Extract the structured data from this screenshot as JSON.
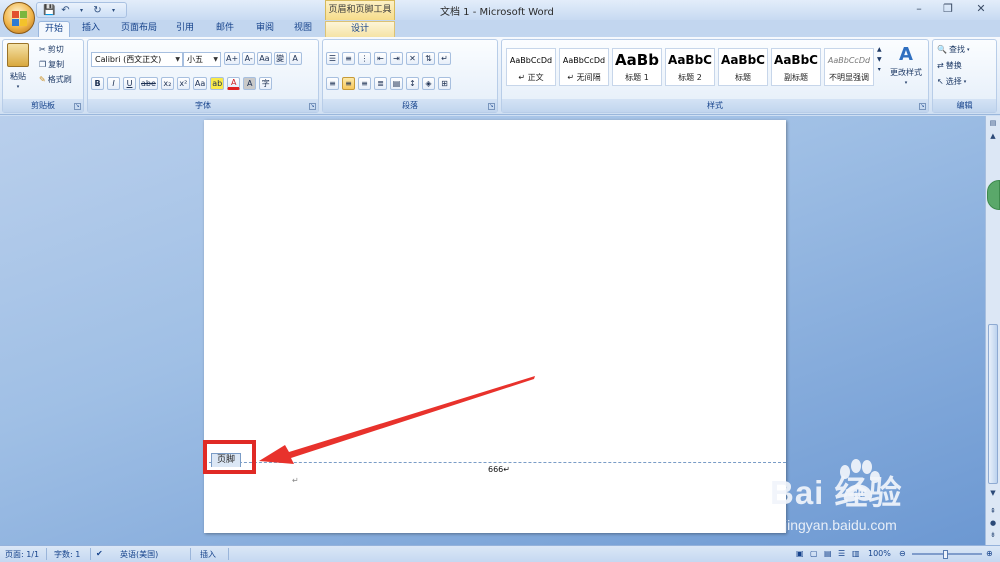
{
  "app": {
    "window_title": "文档 1 - Microsoft Word",
    "contextual_group": "页眉和页脚工具"
  },
  "tabs": [
    {
      "label": "开始",
      "active": true
    },
    {
      "label": "插入"
    },
    {
      "label": "页面布局"
    },
    {
      "label": "引用"
    },
    {
      "label": "邮件"
    },
    {
      "label": "审阅"
    },
    {
      "label": "视图"
    },
    {
      "label": "设计",
      "contextual": true
    }
  ],
  "ribbon": {
    "clipboard": {
      "label": "剪贴板",
      "paste": "粘贴",
      "cut": "剪切",
      "copy": "复制",
      "format_painter": "格式刷"
    },
    "font": {
      "label": "字体",
      "font_name": "Calibri (西文正文)",
      "font_size": "小五",
      "grow_font": "A+",
      "shrink_font": "A-",
      "clear_format": "Aa",
      "phonetic": "變",
      "char_border": "A",
      "bold": "B",
      "italic": "I",
      "underline": "U",
      "strikethrough": "abe",
      "subscript": "x₂",
      "superscript": "x²",
      "change_case": "Aa",
      "highlight": "ab",
      "font_color": "A",
      "char_shading": "A",
      "enclosed": "字"
    },
    "paragraph": {
      "label": "段落"
    },
    "styles": {
      "label": "样式",
      "items": [
        {
          "sample": "AaBbCcDd",
          "name": "↵ 正文"
        },
        {
          "sample": "AaBbCcDd",
          "name": "↵ 无间隔"
        },
        {
          "sample": "AaBb",
          "name": "标题 1"
        },
        {
          "sample": "AaBbC",
          "name": "标题 2"
        },
        {
          "sample": "AaBbC",
          "name": "标题"
        },
        {
          "sample": "AaBbC",
          "name": "副标题"
        },
        {
          "sample": "AaBbCcDd",
          "name": "不明显强调"
        }
      ],
      "change_styles": "更改样式"
    },
    "editing": {
      "label": "编辑",
      "find": "查找",
      "replace": "替换",
      "select": "选择"
    }
  },
  "document": {
    "footer_tag": "页脚",
    "footer_text": "666↵",
    "para_mark": "↵"
  },
  "statusbar": {
    "page": "页面: 1/1",
    "words": "字数: 1",
    "language": "英语(美国)",
    "mode": "插入",
    "zoom": "100%"
  },
  "watermark": {
    "brand": "Bai  经验",
    "url": "jingyan.baidu.com"
  },
  "colors": {
    "highlight_red": "#e02a25",
    "ribbon_blue": "#15428b"
  }
}
